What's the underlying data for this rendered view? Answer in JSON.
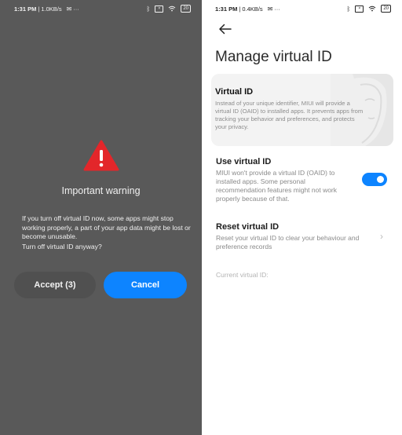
{
  "left_screen": {
    "status": {
      "time": "1:31 PM",
      "net": "1.0KB/s",
      "more": "···",
      "battery": "20"
    },
    "dialog": {
      "title": "Important warning",
      "body": "If you turn off virtual ID now, some apps might stop working properly, a part of your app data might be lost or become unusable.",
      "question": "Turn off virtual ID anyway?",
      "accept_label": "Accept (3)",
      "cancel_label": "Cancel"
    },
    "colors": {
      "warning_red": "#e3262a",
      "accent": "#0d84ff"
    }
  },
  "right_screen": {
    "status": {
      "time": "1:31 PM",
      "net": "0.4KB/s",
      "more": "···",
      "battery": "20"
    },
    "back_icon": "arrow-left-icon",
    "title": "Manage virtual ID",
    "info_card": {
      "title": "Virtual ID",
      "text": "Instead of your unique identifier, MIUI will provide a virtual ID (OAID) to installed apps. It prevents apps from tracking your behavior and preferences, and protects your privacy."
    },
    "use_virtual_id": {
      "title": "Use virtual ID",
      "text": "MIUI won't provide a virtual ID (OAID) to installed apps. Some personal recommendation features might not work properly because of that.",
      "enabled": true
    },
    "reset_virtual_id": {
      "title": "Reset virtual ID",
      "text": "Reset your virtual ID to clear your behaviour and preference records"
    },
    "current_label": "Current virtual ID:"
  }
}
